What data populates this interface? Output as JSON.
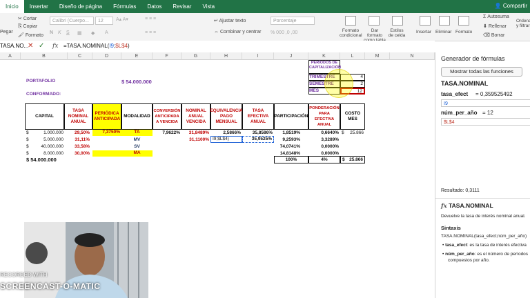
{
  "ribbon": {
    "tabs": [
      "Inicio",
      "Insertar",
      "Diseño de página",
      "Fórmulas",
      "Datos",
      "Revisar",
      "Vista"
    ],
    "active_tab": "Inicio",
    "share": "Compartir",
    "clipboard": {
      "paste": "Pegar",
      "cut": "Cortar",
      "copy": "Copiar",
      "format": "Formato"
    },
    "font": {
      "name": "Calibri (Cuerpo...",
      "size": "12"
    },
    "alignment": {
      "wrap": "Ajustar texto",
      "merge": "Combinar y centrar"
    },
    "number": {
      "format": "Porcentaje"
    },
    "styles": {
      "conditional": "Formato condicional",
      "as_table": "Dar formato como tabla",
      "cell_styles": "Estilos de celda"
    },
    "cells": {
      "insert": "Insertar",
      "delete": "Eliminar",
      "format": "Formato"
    },
    "editing": {
      "autosum": "Autosuma",
      "fill": "Rellenar",
      "clear": "Borrar",
      "sort": "Ordenar y filtrar"
    }
  },
  "formula_bar": {
    "name_box": "TASA.NO...",
    "prefix": "=TASA.NOMINAL(",
    "arg1": "I9",
    "sep": ";",
    "arg2": "$L$4",
    "suffix": ")"
  },
  "columns": [
    "A",
    "B",
    "C",
    "D",
    "E",
    "F",
    "G",
    "H",
    "I",
    "J",
    "K",
    "L",
    "M",
    "N"
  ],
  "sheet": {
    "portafolio_label": "PORTAFOLIO",
    "portafolio_value": "$ 54.000.000",
    "conformado_label": "CONFORMADO:",
    "periodos_title": "PERÍODOS DE CAPITALIZACIÓN",
    "periodos": [
      {
        "name": "TRIMESTRE",
        "value": "4"
      },
      {
        "name": "SEMESTRE",
        "value": "2"
      },
      {
        "name": "MES",
        "value": "12"
      }
    ],
    "headers": [
      "CAPITAL",
      "TASA NOMINAL ANUAL",
      "PERIÓDICA ANTICIPADA",
      "MODALIDAD",
      "CONVERSIÓN ANTICIPADA A VENCIDA",
      "NOMINAL ANUAL VENCIDA",
      "EQUIVALENCIA PAGO MENSUAL",
      "TASA EFECTIVA ANUAL",
      "PARTICIPACIÓN",
      "PONDERACIÓN PARA EFECTIVA ANUAL",
      "COSTO MES"
    ],
    "rows": [
      {
        "currency": "$",
        "capital": "1.000.000",
        "tasa": "29,50%",
        "periodica": "7,3750%",
        "modalidad": "TA",
        "conversion": "7,9622%",
        "nominal": "31,8489%",
        "equivalencia": "2,5866%",
        "efectiva": "35,8586%",
        "participacion": "1,8519%",
        "ponderacion": "0,6640%",
        "costo_cur": "$",
        "costo": "25.866"
      },
      {
        "currency": "$",
        "capital": "5.000.000",
        "tasa": "31,11%",
        "periodica": "",
        "modalidad": "MV",
        "conversion": "",
        "nominal": "31,1100%",
        "equivalencia": "I9;$L$4)",
        "efectiva": "35,9525%",
        "participacion": "9,2593%",
        "ponderacion": "3,3289%",
        "costo_cur": "",
        "costo": ""
      },
      {
        "currency": "$",
        "capital": "40.000.000",
        "tasa": "33,58%",
        "periodica": "",
        "modalidad": "SV",
        "conversion": "",
        "nominal": "",
        "equivalencia": "",
        "efectiva": "",
        "participacion": "74,0741%",
        "ponderacion": "0,0000%",
        "costo_cur": "",
        "costo": ""
      },
      {
        "currency": "$",
        "capital": "8.000.000",
        "tasa": "30,00%",
        "periodica": "",
        "modalidad": "MA",
        "conversion": "",
        "nominal": "",
        "equivalencia": "",
        "efectiva": "",
        "participacion": "14,8148%",
        "ponderacion": "0,0000%",
        "costo_cur": "",
        "costo": ""
      }
    ],
    "total_capital": "$ 54.000.000",
    "total_participacion": "100%",
    "total_ponderacion": "4%",
    "total_costo_cur": "$",
    "total_costo": "25.866"
  },
  "panel": {
    "title": "Generador de fórmulas",
    "show_all": "Mostrar todas las funciones",
    "function_name": "TASA.NOMINAL",
    "arg1_label": "tasa_efect",
    "arg1_value": "= 0,359525492",
    "arg1_input": "I9",
    "arg2_label": "núm_per_año",
    "arg2_value": "= 12",
    "arg2_input": "$L$4",
    "result": "Resultado: 0,3111",
    "fx_title": "TASA.NOMINAL",
    "description": "Devuelve la tasa de interés nominal anual.",
    "syntax_title": "Sintaxis",
    "syntax": "TASA.NOMINAL(tasa_efect;núm_per_año)",
    "bullet1_term": "tasa_efect",
    "bullet1_text": ": es la tasa de interés efectiva",
    "bullet2_term": "núm_per_año",
    "bullet2_text": ": es el número de períodos",
    "bullet2_text2": "compuestos por año."
  },
  "watermark": {
    "line1": "RECORDED WITH",
    "line2": "SCREENCAST-O-MATIC"
  },
  "colors": {
    "excel_green": "#217346",
    "header_red": "#c00000",
    "label_purple": "#7030a0",
    "highlight_yellow": "#ffff00"
  }
}
